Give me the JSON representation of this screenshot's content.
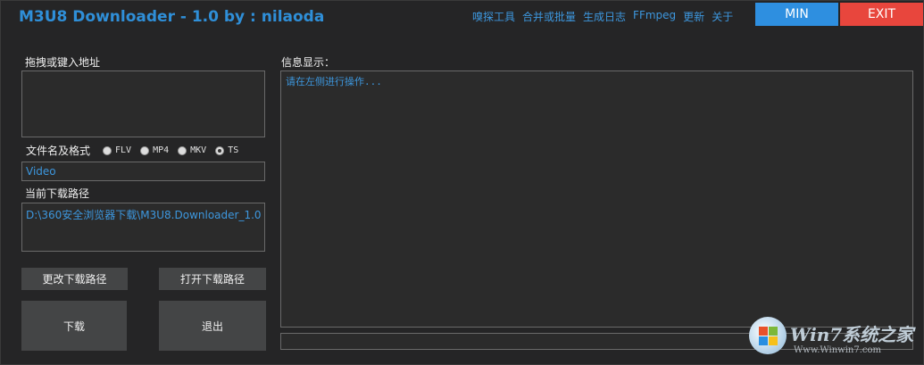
{
  "app": {
    "title": "M3U8 Downloader - 1.0  by : nilaoda"
  },
  "top_menu": [
    "嗅探工具",
    "合并或批量",
    "生成日志",
    "FFmpeg",
    "更新",
    "关于"
  ],
  "window_buttons": {
    "min": "MIN",
    "exit": "EXIT"
  },
  "left": {
    "url_label": "拖拽或键入地址",
    "url_value": "",
    "format_label": "文件名及格式",
    "formats": [
      {
        "label": "FLV",
        "selected": false
      },
      {
        "label": "MP4",
        "selected": false
      },
      {
        "label": "MKV",
        "selected": false
      },
      {
        "label": "TS",
        "selected": true
      }
    ],
    "filename_value": "Video",
    "path_label": "当前下载路径",
    "path_value": "D:\\360安全浏览器下载\\M3U8.Downloader_1.0",
    "change_path_button": "更改下载路径",
    "open_path_button": "打开下载路径",
    "download_button": "下载",
    "quit_button": "退出"
  },
  "right": {
    "info_label": "信息显示：",
    "info_text": "请在左侧进行操作..."
  },
  "watermark": {
    "brand": "Win7系统之家",
    "url": "Www.Winwin7.com"
  },
  "colors": {
    "accent_blue": "#2e8fe0",
    "exit_red": "#e8463d",
    "link_blue": "#3d97de",
    "background": "#252526"
  }
}
